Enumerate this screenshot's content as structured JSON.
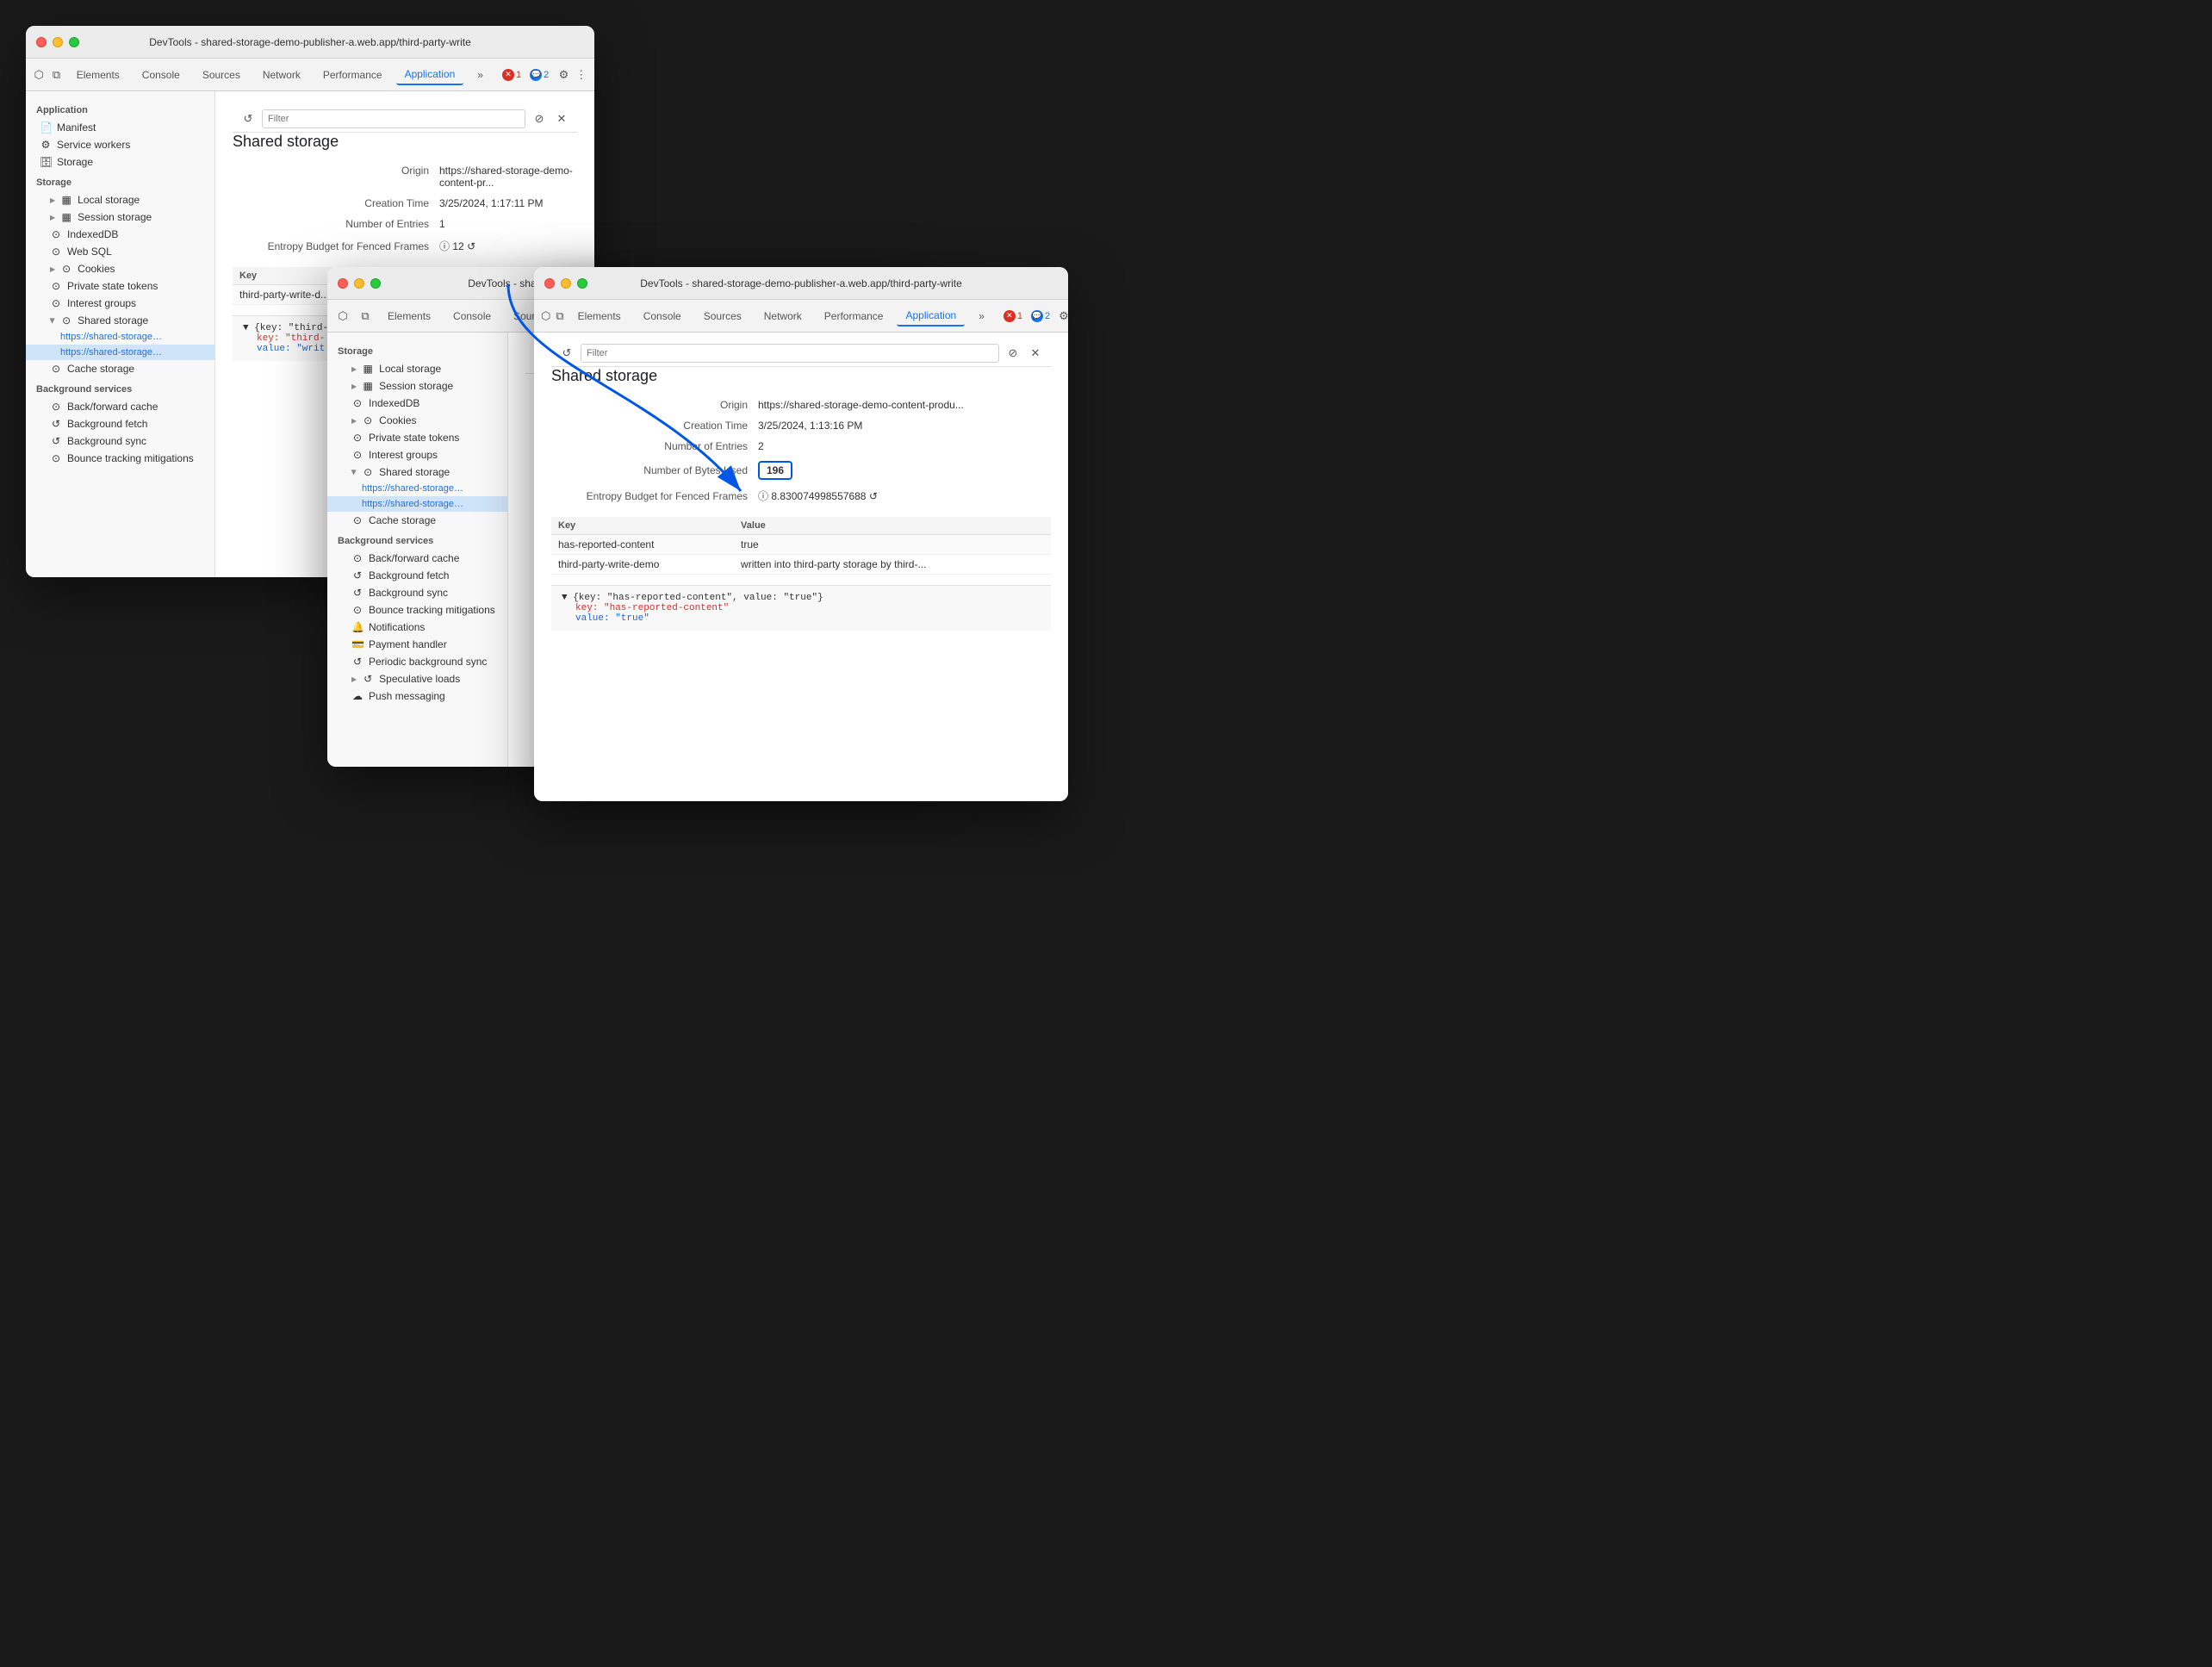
{
  "windows": {
    "back": {
      "title": "DevTools - shared-storage-demo-publisher-a.web.app/third-party-write",
      "tabs": [
        "Elements",
        "Console",
        "Sources",
        "Network",
        "Performance",
        "Application"
      ],
      "active_tab": "Application",
      "filter_placeholder": "Filter",
      "content_title": "Shared storage",
      "origin_label": "Origin",
      "origin_value": "https://shared-storage-demo-content-pr...",
      "creation_time_label": "Creation Time",
      "creation_time_value": "3/25/2024, 1:17:11 PM",
      "num_entries_label": "Number of Entries",
      "num_entries_value": "1",
      "entropy_label": "Entropy Budget for Fenced Frames",
      "entropy_value": "12",
      "table_headers": [
        "Key",
        "Value"
      ],
      "table_rows": [
        [
          "third-party-write-d...",
          ""
        ]
      ],
      "json_line1": "{key: \"third-p",
      "json_key": "key: \"third-",
      "json_value": "value: \"writ",
      "sidebar": {
        "app_section": "Application",
        "app_items": [
          "Manifest",
          "Service workers",
          "Storage"
        ],
        "storage_section": "Storage",
        "storage_items": [
          {
            "label": "Local storage",
            "icon": "▦",
            "expandable": true,
            "indent": 1
          },
          {
            "label": "Session storage",
            "icon": "▦",
            "expandable": true,
            "indent": 1
          },
          {
            "label": "IndexedDB",
            "icon": "⊙",
            "indent": 1
          },
          {
            "label": "Web SQL",
            "icon": "⊙",
            "indent": 1
          },
          {
            "label": "Cookies",
            "icon": "⊙",
            "expandable": true,
            "indent": 1
          },
          {
            "label": "Private state tokens",
            "icon": "⊙",
            "indent": 1
          },
          {
            "label": "Interest groups",
            "icon": "⊙",
            "indent": 1
          },
          {
            "label": "Shared storage",
            "icon": "⊙",
            "expandable": true,
            "indent": 1,
            "open": true
          },
          {
            "label": "https://shared-storage-demo-",
            "icon": "",
            "indent": 2,
            "url": true
          },
          {
            "label": "https://shared-storage-demo-",
            "icon": "",
            "indent": 2,
            "url": true,
            "active": true
          },
          {
            "label": "Cache storage",
            "icon": "⊙",
            "indent": 1
          }
        ],
        "bg_section": "Background services",
        "bg_items": [
          {
            "label": "Back/forward cache",
            "icon": "⊙"
          },
          {
            "label": "Background fetch",
            "icon": "↺"
          },
          {
            "label": "Background sync",
            "icon": "↺"
          },
          {
            "label": "Bounce tracking mitigations",
            "icon": "⊙"
          }
        ]
      }
    },
    "mid": {
      "title": "DevTools - shared-storage-demo-publisher-a.web.app/third-party-write",
      "tabs": [
        "Elements",
        "Console",
        "Sources",
        "Network",
        "Performance",
        "Application"
      ],
      "active_tab": "Application",
      "filter_placeholder": "Filter",
      "sidebar": {
        "storage_section": "Storage",
        "storage_items": [
          {
            "label": "Local storage",
            "icon": "▦",
            "expandable": true
          },
          {
            "label": "Session storage",
            "icon": "▦",
            "expandable": true
          },
          {
            "label": "IndexedDB",
            "icon": "⊙"
          },
          {
            "label": "Cookies",
            "icon": "⊙",
            "expandable": true
          },
          {
            "label": "Private state tokens",
            "icon": "⊙"
          },
          {
            "label": "Interest groups",
            "icon": "⊙"
          },
          {
            "label": "Shared storage",
            "icon": "⊙",
            "expandable": true,
            "open": true
          },
          {
            "label": "https://shared-storage-demo-",
            "url": true
          },
          {
            "label": "https://shared-storage-demo-",
            "url": true,
            "active": true
          },
          {
            "label": "Cache storage",
            "icon": "⊙"
          }
        ],
        "bg_section": "Background services",
        "bg_items": [
          {
            "label": "Back/forward cache",
            "icon": "⊙"
          },
          {
            "label": "Background fetch",
            "icon": "↺"
          },
          {
            "label": "Background sync",
            "icon": "↺"
          },
          {
            "label": "Bounce tracking mitigations",
            "icon": "⊙"
          },
          {
            "label": "Notifications",
            "icon": "🔔"
          },
          {
            "label": "Payment handler",
            "icon": "💳"
          },
          {
            "label": "Periodic background sync",
            "icon": "↺"
          },
          {
            "label": "Speculative loads",
            "icon": "↺",
            "expandable": true
          },
          {
            "label": "Push messaging",
            "icon": "☁"
          }
        ]
      }
    },
    "front": {
      "title": "DevTools - shared-storage-demo-publisher-a.web.app/third-party-write",
      "tabs": [
        "Elements",
        "Console",
        "Sources",
        "Network",
        "Performance",
        "Application"
      ],
      "active_tab": "Application",
      "filter_placeholder": "Filter",
      "content_title": "Shared storage",
      "origin_label": "Origin",
      "origin_value": "https://shared-storage-demo-content-produ...",
      "creation_time_label": "Creation Time",
      "creation_time_value": "3/25/2024, 1:13:16 PM",
      "num_entries_label": "Number of Entries",
      "num_entries_value": "2",
      "num_bytes_label": "Number of Bytes Used",
      "num_bytes_value": "196",
      "entropy_label": "Entropy Budget for Fenced Frames",
      "entropy_value": "8.830074998557688",
      "table_headers": [
        "Key",
        "Value"
      ],
      "table_rows": [
        [
          "has-reported-content",
          "true"
        ],
        [
          "third-party-write-demo",
          "written into third-party storage by third-..."
        ]
      ],
      "json_line": "{key: \"has-reported-content\", value: \"true\"}",
      "json_key": "key: \"has-reported-content\"",
      "json_value": "value: \"true\""
    }
  },
  "badges": {
    "error_count": "1",
    "info_count": "2"
  },
  "icons": {
    "reload": "↺",
    "clear": "⊘",
    "close": "✕",
    "more": "⋮",
    "settings": "⚙",
    "expand_more": "»",
    "pointer": "⬡",
    "layers": "⧉",
    "triangle_right": "▶",
    "triangle_down": "▼"
  }
}
